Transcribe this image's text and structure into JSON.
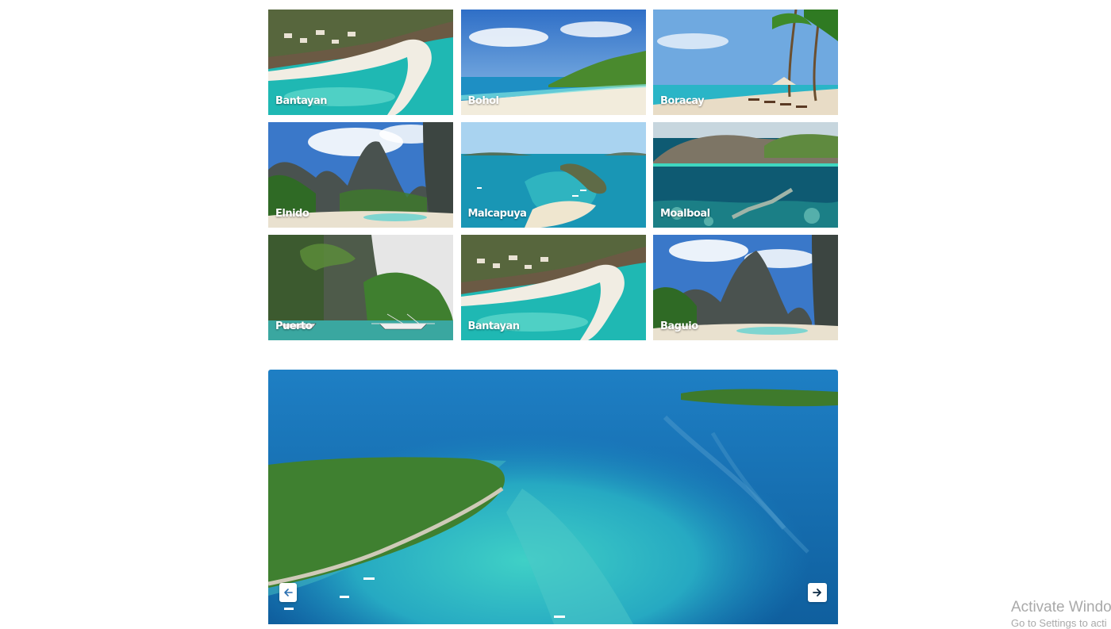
{
  "gallery": {
    "tiles": [
      {
        "label": "Bantayan"
      },
      {
        "label": "Bohol"
      },
      {
        "label": "Boracay"
      },
      {
        "label": "Elnido"
      },
      {
        "label": "Malcapuya"
      },
      {
        "label": "Moalboal"
      },
      {
        "label": "Puerto"
      },
      {
        "label": "Bantayan"
      },
      {
        "label": "Baguio"
      }
    ]
  },
  "carousel": {
    "prev_icon": "arrow-left-icon",
    "next_icon": "arrow-right-icon"
  },
  "watermark": {
    "line1": "Activate Window",
    "line2": "Go to Settings to acti"
  }
}
